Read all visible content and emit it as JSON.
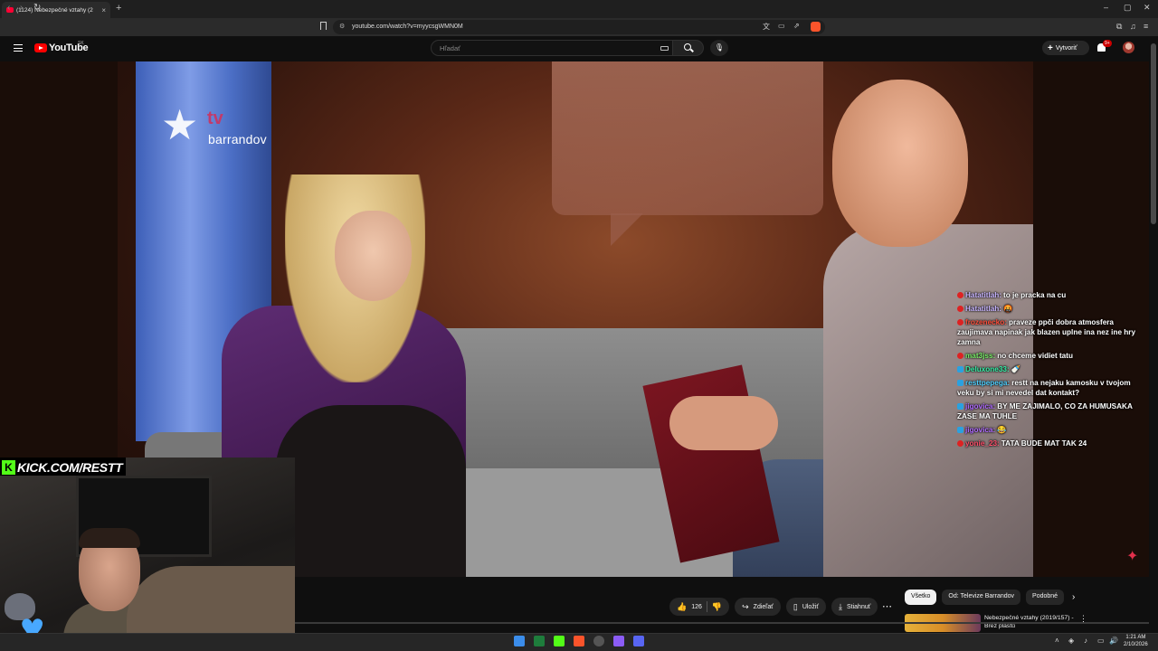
{
  "browser": {
    "tab_title": "(1124) Nebezpečné vztahy (2",
    "tab_close": "×",
    "new_tab": "+",
    "url": "youtube.com/watch?v=myycsgWMN0M",
    "window_controls": [
      "–",
      "▢",
      "✕"
    ]
  },
  "youtube": {
    "logo": "YouTube",
    "country": "SK",
    "search_placeholder": "Hľadať",
    "create_label": "Vytvoriť",
    "notification_badge": "9+"
  },
  "video": {
    "channel_logo_mark": "tv",
    "channel_logo_name": "barrandov",
    "streamer_banner": "KICK.COM/RESTT",
    "kick_letter": "K"
  },
  "chat": [
    {
      "user": "Hatatitlah:",
      "msg": "to je pracka na cu",
      "color": "#c9b6ff",
      "badge": "red"
    },
    {
      "user": "Hatatitlah:",
      "msg": "🤬",
      "color": "#c9b6ff",
      "badge": "red"
    },
    {
      "user": "frozenecko:",
      "msg": "praveze ppči dobra atmosfera zaujimava napinak jak blazen uplne ina nez ine hry zamna",
      "color": "#ff4f3b",
      "badge": "red"
    },
    {
      "user": "mat3jss:",
      "msg": "no chceme vidiet tatu",
      "color": "#7cf06b",
      "badge": "red"
    },
    {
      "user": "Deluxone33:",
      "msg": "🍼",
      "color": "#36f0a8",
      "badge": "blue"
    },
    {
      "user": "resttpepega:",
      "msg": "restt na nejaku kamosku v tvojom veku by si mi nevedel dat kontakt?",
      "color": "#4fd0ff",
      "badge": "blue"
    },
    {
      "user": "jigovica:",
      "msg": "BY ME ZAJIMALO, CO ZA HUMUSAKA ZASE MA TUHLE",
      "color": "#b06bff",
      "badge": "blue"
    },
    {
      "user": "jigovica:",
      "msg": "😂",
      "color": "#b06bff",
      "badge": "blue"
    },
    {
      "user": "yonie_23:",
      "msg": "TATA BUDE MAT TAK 24",
      "color": "#ff4f6b",
      "badge": "red"
    }
  ],
  "actions": {
    "likes": "126",
    "share": "Zdieľať",
    "save": "Uložiť",
    "download": "Stiahnuť"
  },
  "chips": [
    "Všetko",
    "Od: Televize Barrandov",
    "Podobné"
  ],
  "recommendation": {
    "title": "Nebezpečné vztahy (2019/157) - Brez plastů"
  },
  "system": {
    "time": "1:21 AM",
    "date": "2/10/2026"
  },
  "colors": {
    "yt_red": "#ff0000",
    "kick_green": "#53fc18",
    "bg": "#0f0f0f"
  }
}
